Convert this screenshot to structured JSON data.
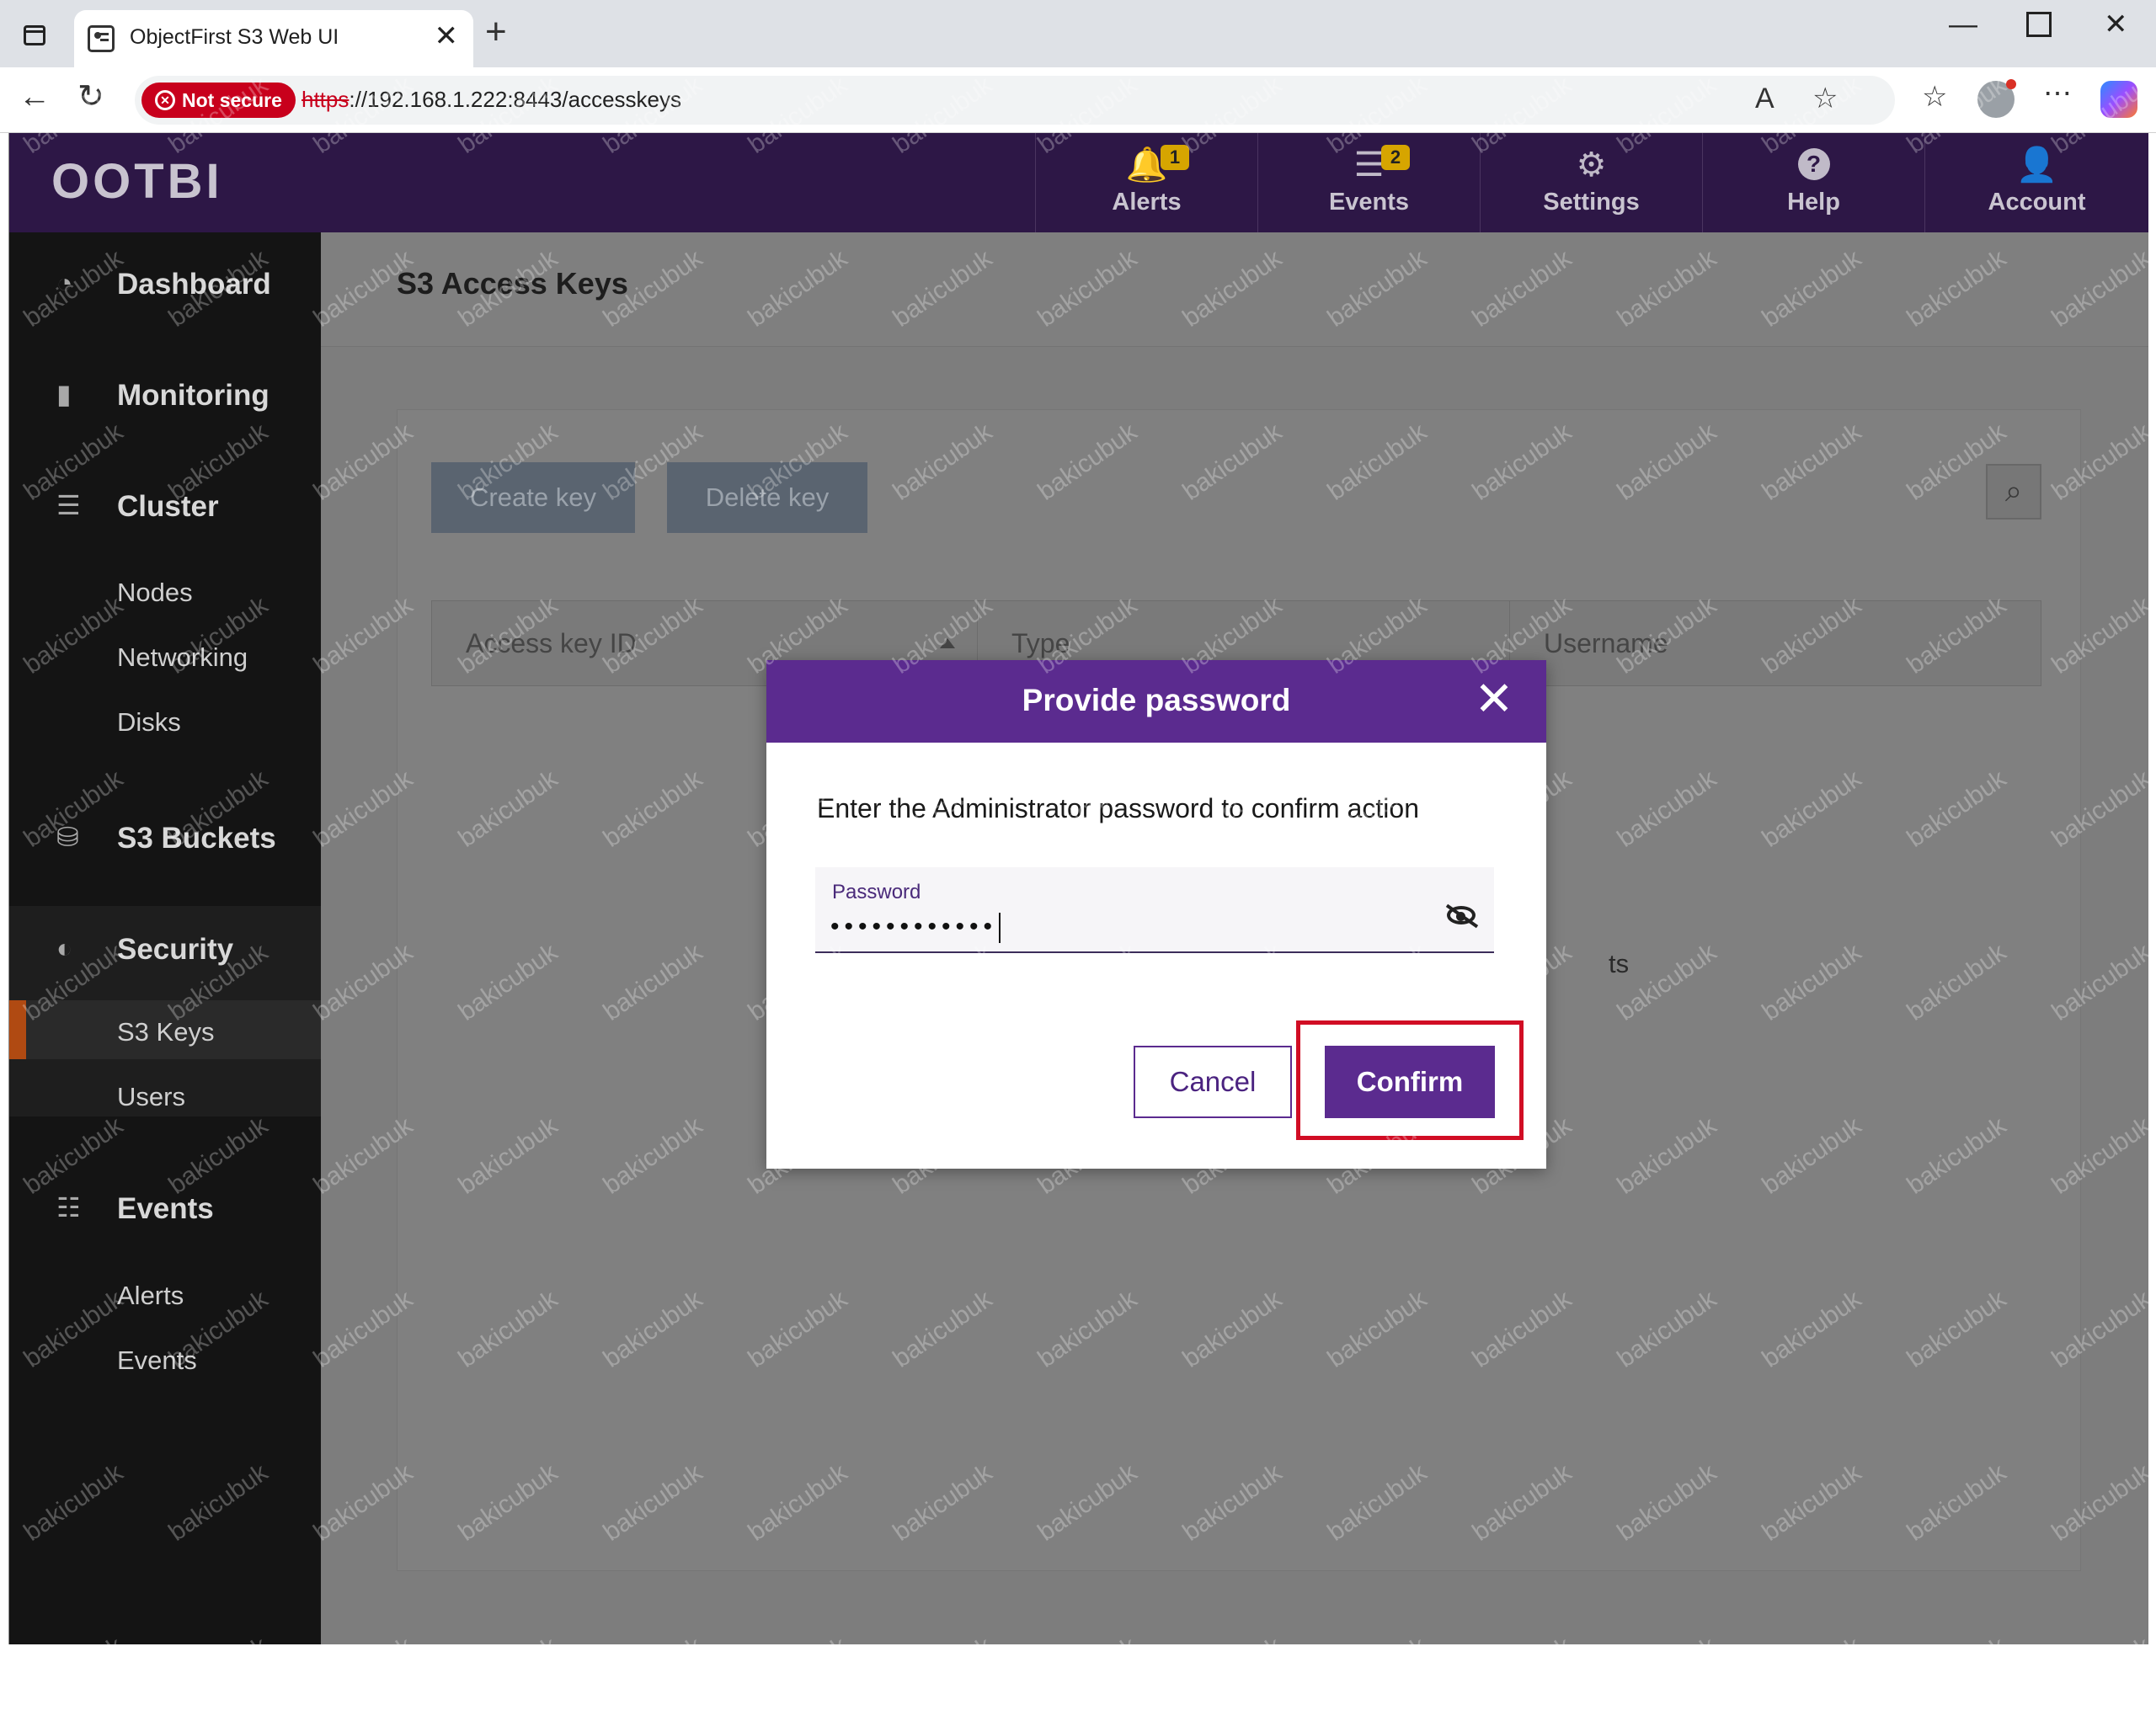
{
  "browser": {
    "tab_title": "ObjectFirst S3 Web UI",
    "not_secure_label": "Not secure",
    "url_scheme": "https",
    "url_rest": "://192.168.1.222:8443/accesskeys"
  },
  "app": {
    "logo": "OOTBI",
    "header_items": [
      {
        "label": "Alerts",
        "icon": "bell-icon",
        "badge": "1"
      },
      {
        "label": "Events",
        "icon": "events-list-icon",
        "badge": "2"
      },
      {
        "label": "Settings",
        "icon": "gear-icon"
      },
      {
        "label": "Help",
        "icon": "help-icon"
      },
      {
        "label": "Account",
        "icon": "user-icon"
      }
    ]
  },
  "sidebar": {
    "dashboard": "Dashboard",
    "monitoring": "Monitoring",
    "cluster": "Cluster",
    "cluster_items": [
      "Nodes",
      "Networking",
      "Disks"
    ],
    "s3_buckets": "S3 Buckets",
    "security": "Security",
    "security_items": [
      "S3 Keys",
      "Users"
    ],
    "events": "Events",
    "events_items": [
      "Alerts",
      "Events"
    ]
  },
  "main": {
    "page_title": "S3 Access Keys",
    "create_key": "Create key",
    "delete_key": "Delete key",
    "columns": [
      "Access key ID",
      "Type",
      "Username"
    ],
    "partial_text": "ts"
  },
  "modal": {
    "title": "Provide password",
    "message": "Enter the Administrator password to confirm action",
    "password_label": "Password",
    "password_mask": "••••••••••••",
    "cancel": "Cancel",
    "confirm": "Confirm"
  },
  "watermark": "bakicubuk",
  "colors": {
    "header_bg": "#2d1746",
    "modal_accent": "#5b2b8f",
    "highlight": "#d10d24",
    "badge": "#d6a500"
  }
}
